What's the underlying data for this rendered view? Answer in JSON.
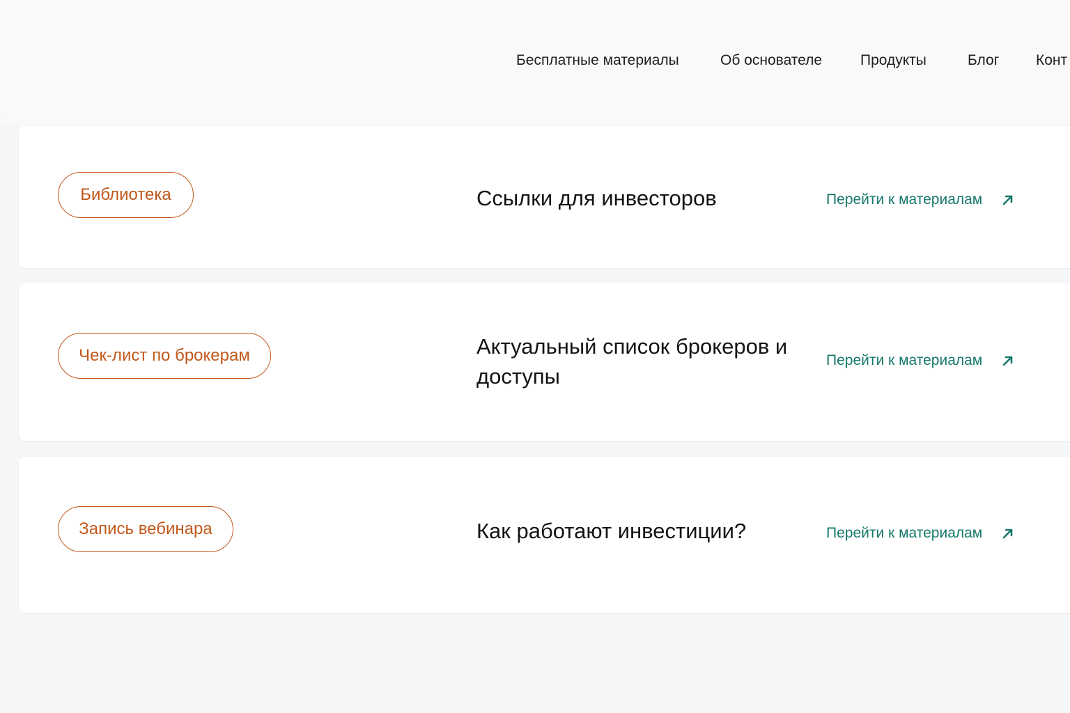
{
  "nav": {
    "items": [
      {
        "label": "Бесплатные материалы"
      },
      {
        "label": "Об основателе"
      },
      {
        "label": "Продукты"
      },
      {
        "label": "Блог"
      },
      {
        "label": "Конт"
      }
    ]
  },
  "cards": [
    {
      "tag": "Библиотека",
      "title": "Ссылки для инвесторов",
      "link": "Перейти к материалам",
      "link_icon": "arrow-up-right-icon"
    },
    {
      "tag": "Чек-лист по брокерам",
      "title": "Актуальный список брокеров и доступы",
      "link": "Перейти к материалам",
      "link_icon": "arrow-up-right-icon"
    },
    {
      "tag": "Запись вебинара",
      "title": "Как работают инвестиции?",
      "link": "Перейти к материалам",
      "link_icon": "arrow-up-right-icon"
    }
  ],
  "colors": {
    "accent_orange": "#c0581b",
    "link_teal": "#17786b",
    "background": "#f5f6f7",
    "card": "#ffffff"
  }
}
